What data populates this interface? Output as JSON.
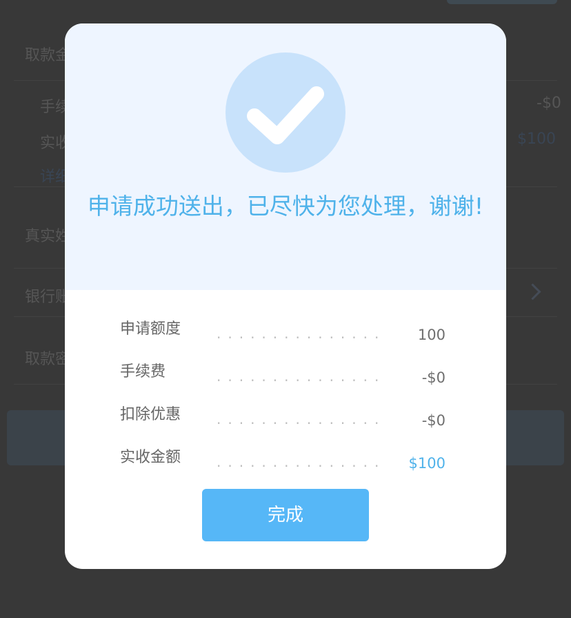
{
  "background": {
    "rows": [
      {
        "label": "取款金"
      },
      {
        "label": "手续",
        "value": "-$0"
      },
      {
        "label": "实收",
        "value": "$100"
      },
      {
        "label": "详细"
      },
      {
        "label": "真实姓"
      },
      {
        "label": "银行账"
      },
      {
        "label": "取款密"
      }
    ]
  },
  "modal": {
    "icon": "check-circle-icon",
    "message": "申请成功送出，已尽快为您处理，谢谢!",
    "details": [
      {
        "label": "申请额度",
        "dots": "...............",
        "value": "100"
      },
      {
        "label": "手续费",
        "dots": "...............",
        "value": "-$0"
      },
      {
        "label": "扣除优惠",
        "dots": "...............",
        "value": "-$0"
      },
      {
        "label": "实收金额",
        "dots": "...............",
        "value": "$100"
      }
    ],
    "done_label": "完成"
  },
  "colors": {
    "accent": "#4fb2ea",
    "button": "#56b7f7",
    "header_bg": "#eef5ff"
  }
}
